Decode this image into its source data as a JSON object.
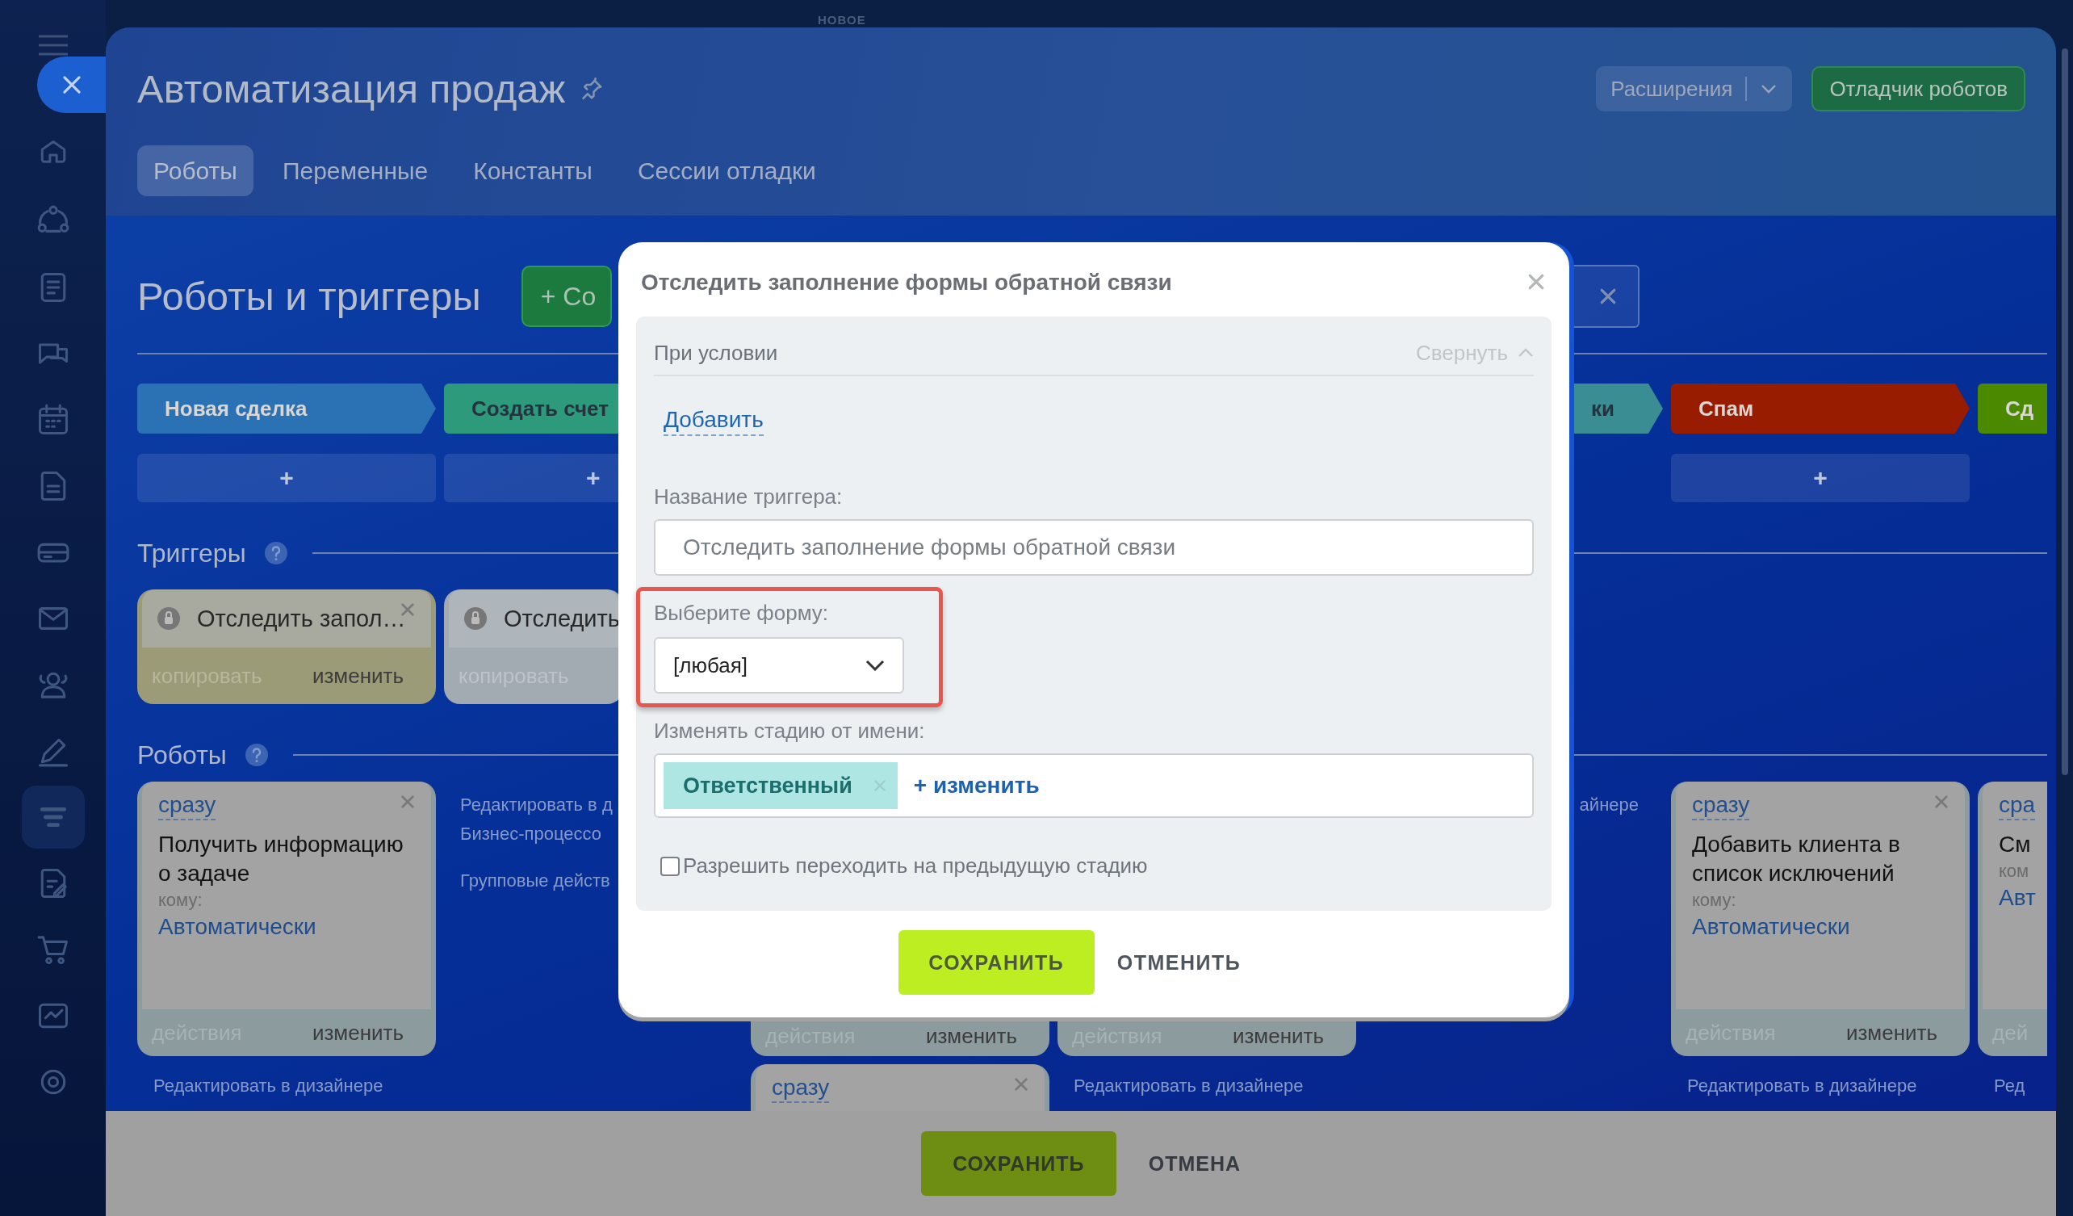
{
  "top_label": "НОВОЕ",
  "header": {
    "title": "Автоматизация продаж",
    "extensions_button": "Расширения",
    "debugger_button": "Отладчик роботов",
    "tabs": [
      {
        "label": "Роботы",
        "selected": true
      },
      {
        "label": "Переменные",
        "selected": false
      },
      {
        "label": "Константы",
        "selected": false
      },
      {
        "label": "Сессии отладки",
        "selected": false
      }
    ]
  },
  "section_title": "Роботы и триггеры",
  "create_button": "+ Со",
  "triggers_title": "Триггеры",
  "robots_title": "Роботы",
  "columns": [
    {
      "stage": {
        "label": "Новая сделка",
        "color": "#2a72b3"
      },
      "add": "+",
      "trigger": {
        "title": "Отследить запол…",
        "copy": "копировать",
        "edit": "изменить",
        "selected": true
      },
      "robots": [
        {
          "delay": "сразу",
          "title": "Получить информацию о задаче",
          "to_label": "кому:",
          "to_value": "Автоматически",
          "actions": "действия",
          "edit": "изменить"
        }
      ],
      "links": [
        "Редактировать в дизайнере"
      ]
    },
    {
      "stage": {
        "label": "Создать счет",
        "color": "#2e9a7c"
      },
      "add": "+",
      "trigger": {
        "title": "Отследить",
        "copy": "копировать",
        "selected": false
      },
      "links": [
        "Редактировать в д",
        "Бизнес-процессо",
        "Групповые действ"
      ]
    },
    {
      "robots": [
        {
          "actions": "действия",
          "edit": "изменить"
        },
        {
          "delay": "сразу"
        }
      ]
    },
    {
      "robots": [
        {
          "actions": "действия",
          "edit": "изменить"
        }
      ],
      "links": [
        "Редактировать в дизайнере"
      ]
    },
    {
      "stage": {
        "label": "ки",
        "color": "#3a8d92"
      },
      "links": [
        "айнере"
      ]
    },
    {
      "stage": {
        "label": "Спам",
        "color": "#981c00"
      },
      "add": "+",
      "robots": [
        {
          "delay": "сразу",
          "title": "Добавить клиента в список исключений",
          "to_label": "кому:",
          "to_value": "Автоматически",
          "actions": "действия",
          "edit": "изменить"
        }
      ],
      "links": [
        "Редактировать в дизайнере"
      ]
    },
    {
      "stage": {
        "label": "Сд",
        "color": "#4b8a00"
      },
      "robots": [
        {
          "delay": "сра",
          "title": "См",
          "to_label": "ком",
          "to_value": "Авт",
          "actions": "дей"
        }
      ],
      "links": [
        "Ред"
      ]
    }
  ],
  "dialog": {
    "title": "Отследить заполнение формы обратной связи",
    "condition": {
      "label": "При условии",
      "collapse": "Свернуть",
      "expanded": true,
      "add": "Добавить"
    },
    "name_label": "Название триггера:",
    "name_value": "Отследить заполнение формы обратной связи",
    "form_label": "Выберите форму:",
    "form_value": "[любая]",
    "stage_label": "Изменять стадию от имени:",
    "stage_tag": "Ответственный",
    "stage_change": "+ изменить",
    "allow_back": {
      "label": "Разрешить переходить на предыдущую стадию",
      "checked": false
    },
    "save": "СОХРАНИТЬ",
    "cancel": "ОТМЕНИТЬ"
  },
  "footer": {
    "save": "СОХРАНИТЬ",
    "cancel": "ОТМЕНА"
  }
}
